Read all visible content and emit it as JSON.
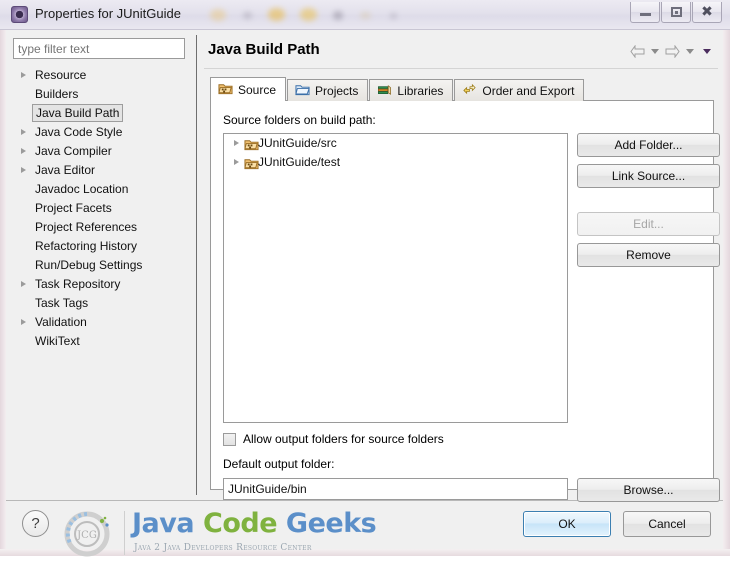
{
  "window": {
    "title": "Properties for JUnitGuide",
    "icon": "eclipse-properties-icon",
    "minimize_label": "Minimize",
    "maximize_label": "Maximize",
    "close_label": "Close"
  },
  "sidebar": {
    "filter": {
      "placeholder": "type filter text",
      "value": ""
    },
    "items": [
      {
        "label": "Resource",
        "expandable": true,
        "selected": false
      },
      {
        "label": "Builders",
        "expandable": false,
        "selected": false
      },
      {
        "label": "Java Build Path",
        "expandable": false,
        "selected": true
      },
      {
        "label": "Java Code Style",
        "expandable": true,
        "selected": false
      },
      {
        "label": "Java Compiler",
        "expandable": true,
        "selected": false
      },
      {
        "label": "Java Editor",
        "expandable": true,
        "selected": false
      },
      {
        "label": "Javadoc Location",
        "expandable": false,
        "selected": false
      },
      {
        "label": "Project Facets",
        "expandable": false,
        "selected": false
      },
      {
        "label": "Project References",
        "expandable": false,
        "selected": false
      },
      {
        "label": "Refactoring History",
        "expandable": false,
        "selected": false
      },
      {
        "label": "Run/Debug Settings",
        "expandable": false,
        "selected": false
      },
      {
        "label": "Task Repository",
        "expandable": true,
        "selected": false
      },
      {
        "label": "Task Tags",
        "expandable": false,
        "selected": false
      },
      {
        "label": "Validation",
        "expandable": true,
        "selected": false
      },
      {
        "label": "WikiText",
        "expandable": false,
        "selected": false
      }
    ]
  },
  "page": {
    "title": "Java Build Path",
    "nav": {
      "back_icon": "arrow-left-icon",
      "back_dropdown_icon": "chevron-down-icon",
      "forward_icon": "arrow-right-icon",
      "forward_dropdown_icon": "chevron-down-icon",
      "menu_icon": "chevron-down-icon"
    },
    "tabs": [
      {
        "label": "Source",
        "icon": "package-folder-icon",
        "active": true
      },
      {
        "label": "Projects",
        "icon": "blue-folder-icon",
        "active": false
      },
      {
        "label": "Libraries",
        "icon": "books-icon",
        "active": false
      },
      {
        "label": "Order and Export",
        "icon": "order-export-icon",
        "active": false
      }
    ],
    "source_tab": {
      "list_label": "Source folders on build path:",
      "entries": [
        {
          "label": "JUnitGuide/src",
          "icon": "package-folder-icon",
          "expandable": true
        },
        {
          "label": "JUnitGuide/test",
          "icon": "package-folder-icon",
          "expandable": true
        }
      ],
      "buttons": [
        {
          "label": "Add Folder...",
          "enabled": true
        },
        {
          "label": "Link Source...",
          "enabled": true
        },
        {
          "label": "Edit...",
          "enabled": false
        },
        {
          "label": "Remove",
          "enabled": true
        }
      ],
      "allow_output_folders": {
        "label": "Allow output folders for source folders",
        "checked": false
      },
      "default_output": {
        "label": "Default output folder:",
        "value": "JUnitGuide/bin",
        "browse_label": "Browse..."
      }
    }
  },
  "footer": {
    "help_label": "?",
    "ok_label": "OK",
    "cancel_label": "Cancel"
  },
  "watermark": {
    "word1": "Java",
    "word2": "Code",
    "word3": "Geeks",
    "tagline": "Java 2 Java Developers Resource Center",
    "logo_text": "JCG",
    "colors": {
      "blue": "#5b8fc9",
      "green": "#7fb23f"
    }
  }
}
